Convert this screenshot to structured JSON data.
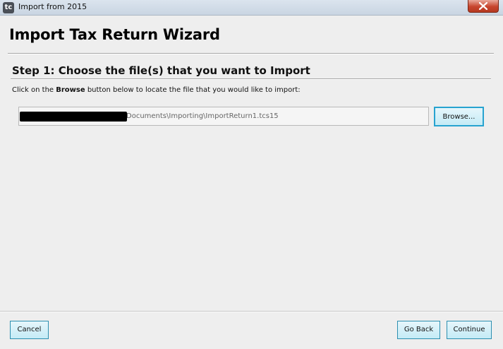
{
  "window": {
    "title": "Import from 2015",
    "icon_label": "tc"
  },
  "wizard": {
    "title": "Import Tax Return Wizard",
    "step_title": "Step 1: Choose the file(s) that you want to Import",
    "instruction_prefix": "Click on the ",
    "instruction_bold": "Browse",
    "instruction_suffix": " button below to locate the file that you would like to import:",
    "file_path_visible": "Documents\\Importing\\ImportReturn1.tcs15"
  },
  "buttons": {
    "browse": "Browse...",
    "cancel": "Cancel",
    "go_back": "Go Back",
    "continue": "Continue"
  },
  "colors": {
    "accent_border": "#27a3d0",
    "button_fill": "#c4ebf6",
    "close_button": "#c7452d"
  }
}
